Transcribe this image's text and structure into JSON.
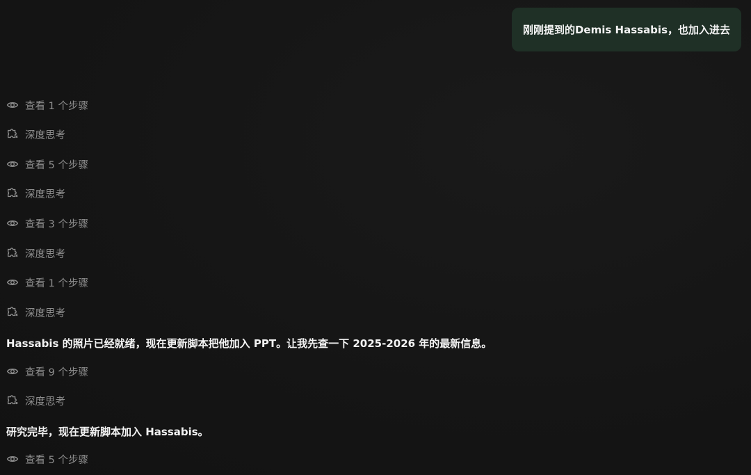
{
  "user_message": "刚刚提到的Demis Hassabis，也加入进去",
  "steps": [
    {
      "kind": "view",
      "label": "查看 1 个步骤"
    },
    {
      "kind": "think",
      "label": "深度思考"
    },
    {
      "kind": "view",
      "label": "查看 5 个步骤"
    },
    {
      "kind": "think",
      "label": "深度思考"
    },
    {
      "kind": "view",
      "label": "查看 3 个步骤"
    },
    {
      "kind": "think",
      "label": "深度思考"
    },
    {
      "kind": "view",
      "label": "查看 1 个步骤"
    },
    {
      "kind": "think",
      "label": "深度思考"
    }
  ],
  "assistant_message_1": "Hassabis 的照片已经就绪，现在更新脚本把他加入 PPT。让我先查一下 2025-2026 年的最新信息。",
  "steps_2": [
    {
      "kind": "view",
      "label": "查看 9 个步骤"
    },
    {
      "kind": "think",
      "label": "深度思考"
    }
  ],
  "assistant_message_2": "研究完毕，现在更新脚本加入 Hassabis。",
  "steps_3": [
    {
      "kind": "view",
      "label": "查看 5 个步骤"
    }
  ],
  "colors": {
    "background": "#141414",
    "user_bubble": "#1f3026",
    "muted_text": "#8e8e8e",
    "primary_text": "#f3f3f3"
  }
}
